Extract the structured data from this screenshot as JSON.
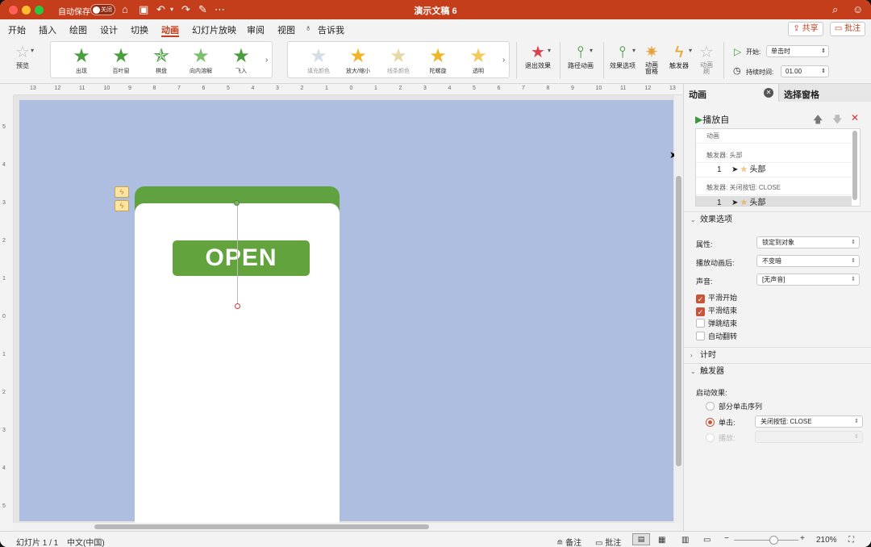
{
  "window": {
    "autosave_label": "自动保存",
    "autosave_state": "关闭",
    "title": "演示文稿 6"
  },
  "tabs": [
    "开始",
    "插入",
    "绘图",
    "设计",
    "切换",
    "动画",
    "幻灯片放映",
    "审阅",
    "视图"
  ],
  "active_tab": "动画",
  "tell_me": "告诉我",
  "share_label": "共享",
  "comments_label": "批注",
  "ribbon": {
    "preview_label": "预览",
    "entrance_effects": [
      "出现",
      "百叶窗",
      "棋盘",
      "向内溶解",
      "飞入"
    ],
    "emphasis_effects": [
      "填充颜色",
      "放大/缩小",
      "线条颜色",
      "陀螺旋",
      "透明"
    ],
    "exit_label": "退出效果",
    "path_label": "路径动画",
    "effect_options_label": "效果选项",
    "anim_pane_label": "动画\n窗格",
    "trigger_label": "触发器",
    "anim_brush_label": "动画\n刷",
    "start_label": "开始:",
    "start_value": "单击时",
    "duration_label": "持续时间:",
    "duration_value": "01.00"
  },
  "ruler": {
    "top": [
      "13",
      "12",
      "11",
      "10",
      "9",
      "8",
      "7",
      "6",
      "5",
      "4",
      "3",
      "2",
      "1",
      "0",
      "1",
      "2",
      "3",
      "4",
      "5",
      "6",
      "7",
      "8",
      "9",
      "10",
      "11",
      "12",
      "13"
    ],
    "left": [
      "5",
      "4",
      "3",
      "2",
      "1",
      "0",
      "1",
      "2",
      "3",
      "4",
      "5"
    ]
  },
  "slide": {
    "button_text": "OPEN"
  },
  "pane": {
    "tab_animation": "动画",
    "tab_selection": "选择窗格",
    "play_from": "播放自",
    "list": {
      "header": "动画",
      "trigger1": "触发器: 头部",
      "item1_num": "1",
      "item1_name": "头部",
      "trigger2": "触发器: 关闭按钮: CLOSE",
      "item2_num": "1",
      "item2_name": "头部"
    },
    "effect_options": {
      "title": "效果选项",
      "property_label": "属性:",
      "property_value": "锁定到对象",
      "after_label": "播放动画后:",
      "after_value": "不变暗",
      "sound_label": "声音:",
      "sound_value": "[无声音]",
      "smooth_start": "平滑开始",
      "smooth_start_checked": true,
      "smooth_end": "平滑结束",
      "smooth_end_checked": true,
      "bounce_end": "弹跳结束",
      "bounce_end_checked": false,
      "auto_reverse": "自动翻转",
      "auto_reverse_checked": false
    },
    "timing_title": "计时",
    "trigger": {
      "title": "触发器",
      "start_effect_label": "启动效果:",
      "part_of_click_sequence": "部分单击序列",
      "on_click_label": "单击:",
      "on_click_value": "关闭按钮: CLOSE",
      "on_play_label": "播放:"
    }
  },
  "status": {
    "slide_info": "幻灯片 1 / 1",
    "language": "中文(中国)",
    "notes": "备注",
    "comments": "批注",
    "zoom": "210%"
  }
}
